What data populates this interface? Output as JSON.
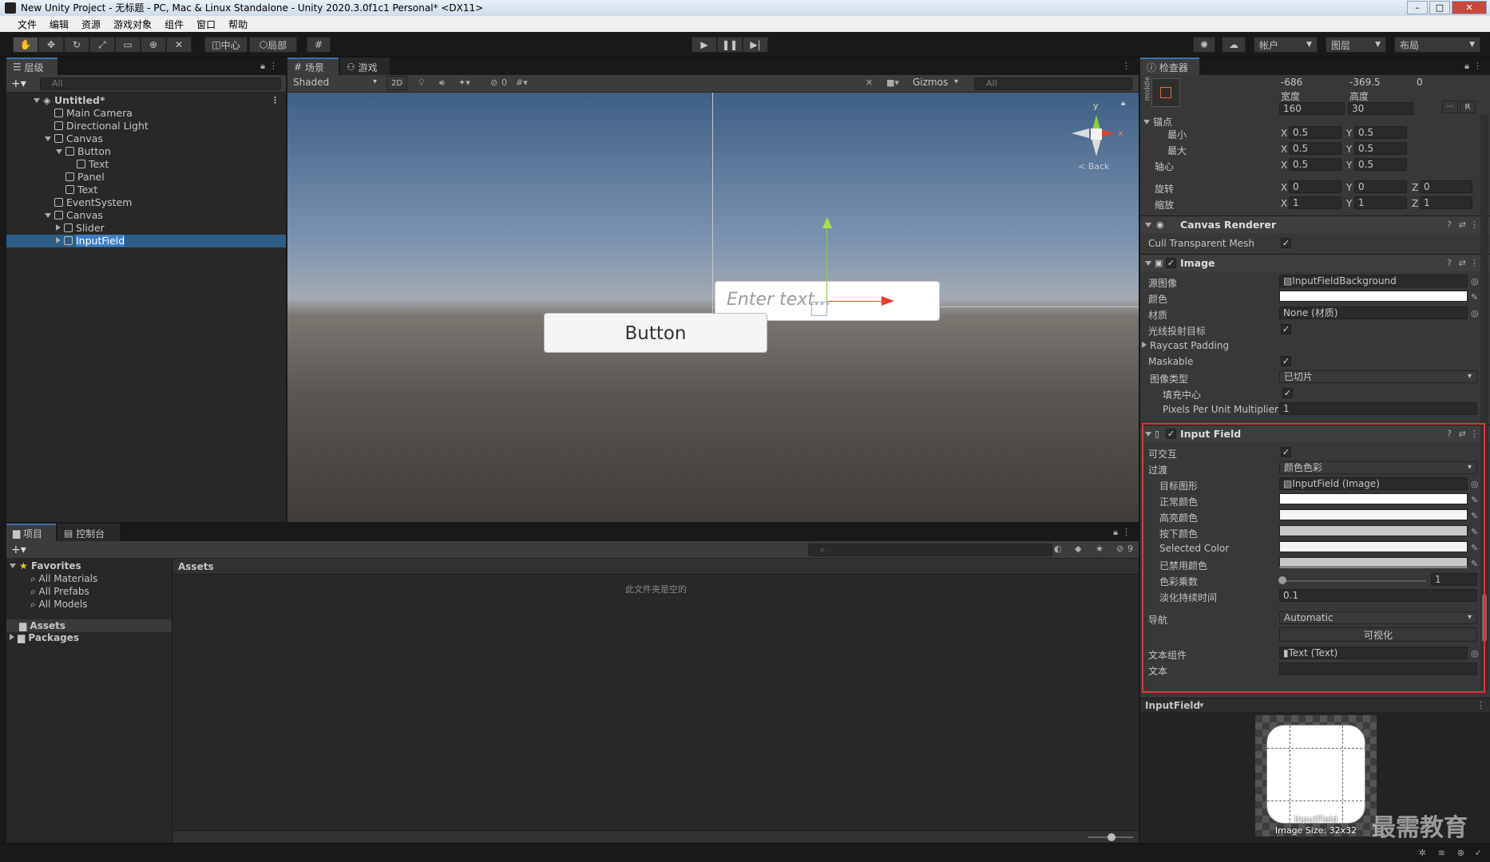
{
  "window": {
    "title": "New Unity Project - 无标题 - PC, Mac & Linux Standalone - Unity 2020.3.0f1c1 Personal* <DX11>",
    "btn_min": "–",
    "btn_max": "□",
    "btn_close": "✕"
  },
  "menu": [
    "文件",
    "编辑",
    "资源",
    "游戏对象",
    "组件",
    "窗口",
    "帮助"
  ],
  "toolbar": {
    "pivot_center": "中心",
    "pivot_local": "局部",
    "account": "帐户",
    "layers": "图层",
    "layout": "布局"
  },
  "hierarchy": {
    "tab": "层级",
    "search_placeholder": "All",
    "items": [
      {
        "label": "Untitled*",
        "depth": 0
      },
      {
        "label": "Main Camera",
        "depth": 1
      },
      {
        "label": "Directional Light",
        "depth": 1
      },
      {
        "label": "Canvas",
        "depth": 1
      },
      {
        "label": "Button",
        "depth": 2
      },
      {
        "label": "Text",
        "depth": 3
      },
      {
        "label": "Panel",
        "depth": 2
      },
      {
        "label": "Text",
        "depth": 2
      },
      {
        "label": "EventSystem",
        "depth": 1
      },
      {
        "label": "Canvas",
        "depth": 1
      },
      {
        "label": "Slider",
        "depth": 2
      },
      {
        "label": "InputField",
        "depth": 2
      }
    ]
  },
  "scene": {
    "tab_scene": "场景",
    "tab_game": "游戏",
    "shading": "Shaded",
    "mode_2d": "2D",
    "hidden_count": "0",
    "gizmos": "Gizmos",
    "search_placeholder": "All",
    "back_label": "< Back",
    "input_placeholder": "Enter text...",
    "button_label": "Button",
    "gizmo_y": "y",
    "gizmo_x": "x"
  },
  "project": {
    "tab_project": "项目",
    "tab_console": "控制台",
    "favorites": "Favorites",
    "fav_items": [
      "All Materials",
      "All Prefabs",
      "All Models"
    ],
    "assets": "Assets",
    "packages": "Packages",
    "breadcrumb": "Assets",
    "empty_msg": "此文件夹是空的",
    "hidden_count": "9"
  },
  "inspector": {
    "tab": "检查器",
    "anchor_label": "middle",
    "pos_x": "-686",
    "pos_y": "-369.5",
    "pos_z": "0",
    "width_label": "宽度",
    "height_label": "高度",
    "width": "160",
    "height": "30",
    "anchors_label": "锚点",
    "min_label": "最小",
    "max_label": "最大",
    "pivot_label": "轴心",
    "rotation_label": "旋转",
    "scale_label": "缩放",
    "min_x": "0.5",
    "min_y": "0.5",
    "max_x": "0.5",
    "max_y": "0.5",
    "pivot_x": "0.5",
    "pivot_y": "0.5",
    "rot_x": "0",
    "rot_y": "0",
    "rot_z": "0",
    "scale_x": "1",
    "scale_y": "1",
    "scale_z": "1",
    "axis_x": "X",
    "axis_y": "Y",
    "axis_z": "Z",
    "btn_r": "R",
    "canvas_renderer": "Canvas Renderer",
    "cull_mesh": "Cull Transparent Mesh",
    "image": "Image",
    "source_image_label": "源图像",
    "source_image": "InputFieldBackground",
    "color_label": "颜色",
    "material_label": "材质",
    "material": "None (材质)",
    "raycast_target": "光线投射目标",
    "raycast_padding": "Raycast Padding",
    "maskable": "Maskable",
    "image_type_label": "图像类型",
    "image_type": "已切片",
    "fill_center": "填充中心",
    "ppu_label": "Pixels Per Unit Multiplier",
    "ppu": "1",
    "input_field": "Input Field",
    "interactable": "可交互",
    "transition_label": "过渡",
    "transition": "颜色色彩",
    "target_graphic_label": "目标图形",
    "target_graphic": "InputField (Image)",
    "normal_color": "正常颜色",
    "highlighted_color": "高亮颜色",
    "pressed_color": "按下颜色",
    "selected_color": "Selected Color",
    "disabled_color": "已禁用颜色",
    "color_multiplier_label": "色彩乘数",
    "color_multiplier": "1",
    "fade_duration_label": "淡化持续时间",
    "fade_duration": "0.1",
    "navigation_label": "导航",
    "navigation": "Automatic",
    "visualize": "可视化",
    "text_component_label": "文本组件",
    "text_component": "Text (Text)",
    "text_label": "文本",
    "preview_title": "InputField",
    "preview_name": "InputField",
    "preview_size": "Image Size: 32x32",
    "watermark": "最需教育"
  },
  "colors": {
    "accent": "#3a72b0",
    "selection": "#2c5d87",
    "highlight_box": "#e0353a"
  }
}
